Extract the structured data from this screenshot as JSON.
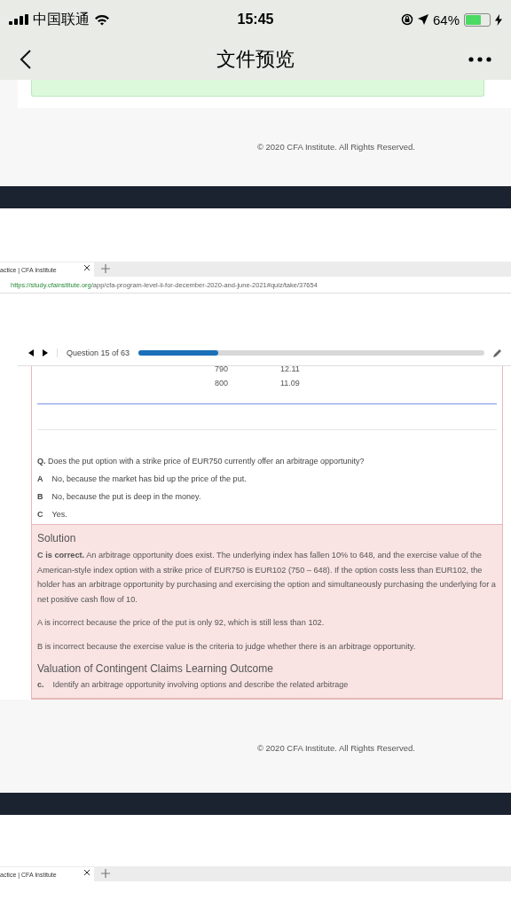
{
  "status_bar": {
    "carrier": "中国联通",
    "time": "15:45",
    "battery": "64%"
  },
  "nav_bar": {
    "title": "文件预览"
  },
  "footer_top": "© 2020 CFA Institute. All Rights Reserved.",
  "browser": {
    "tab": "actice | CFA Institute",
    "url_host": "https://study.cfainstitute.org/",
    "url_path": "app/cfa-program-level-ii-for-december-2020-and-june-2021#quiz/take/37654"
  },
  "quiz": {
    "counter": "Question 15 of 63",
    "level": 0.23,
    "table_rows": [
      [
        "790",
        "12.11"
      ],
      [
        "800",
        "11.09"
      ]
    ],
    "question_label": "Q.",
    "question": "Does the put option with a strike price of EUR750 currently offer an arbitrage opportunity?",
    "options": [
      {
        "letter": "A",
        "text": "No, because the market has bid up the price of the put."
      },
      {
        "letter": "B",
        "text": "No, because the put is deep in the money."
      },
      {
        "letter": "C",
        "text": "Yes."
      }
    ],
    "solution": {
      "title": "Solution",
      "paragraphs": [
        "**C is correct.** An arbitrage opportunity does exist. The underlying index has fallen 10% to 648, and the exercise value of the American-style index option with a strike price of EUR750 is EUR102 (750 – 648). If the option costs less than EUR102, the holder has an arbitrage opportunity by purchasing and exercising the option and simultaneously purchasing the underlying for a net positive cash flow of 10.",
        "A is incorrect because the price of the put is only 92, which is still less than 102.",
        "B is incorrect because the exercise value is the criteria to judge whether there is an arbitrage opportunity."
      ],
      "outcome_title": "Valuation of Contingent Claims Learning Outcome",
      "outcome_letter": "c.",
      "outcome_text": "Identify an arbitrage opportunity involving options and describe the related arbitrage"
    }
  },
  "footer_bottom": "© 2020 CFA Institute. All Rights Reserved.",
  "browser_bottom": {
    "tab": "actice | CFA Institute"
  }
}
